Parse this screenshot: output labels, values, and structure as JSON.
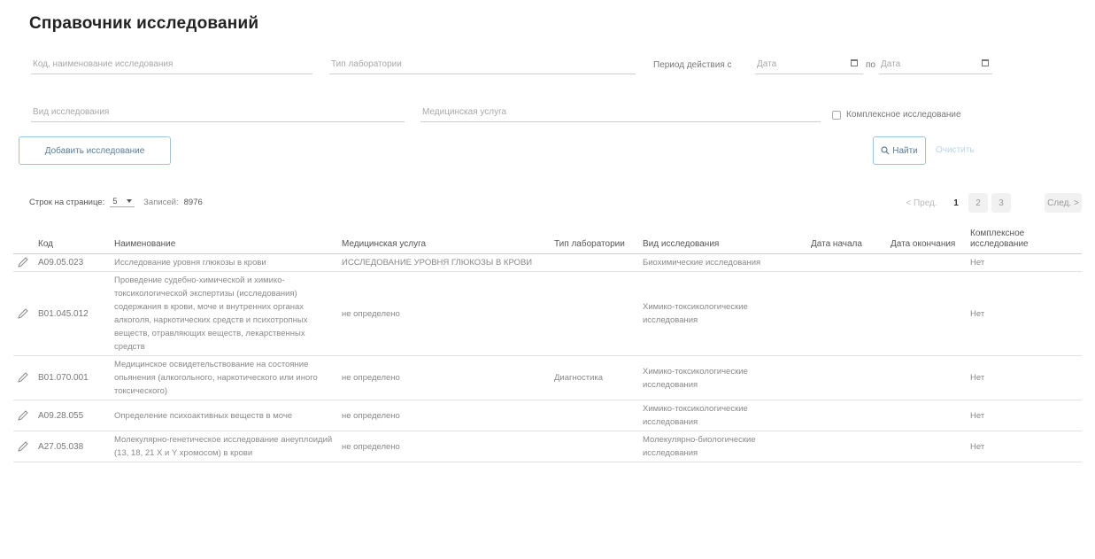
{
  "page": {
    "title": "Справочник исследований"
  },
  "filters": {
    "code_placeholder": "Код, наименование исследования",
    "lab_type_placeholder": "Тип лаборатории",
    "period_label": "Период действия с",
    "date_from_placeholder": "Дата",
    "to_label": "по",
    "date_to_placeholder": "Дата",
    "study_type_placeholder": "Вид исследования",
    "med_service_placeholder": "Медицинская услуга",
    "complex_label": "Комплексное исследование"
  },
  "actions": {
    "add_label": "Добавить исследование",
    "find_label": "Найти",
    "clear_label": "Очистить"
  },
  "pagination": {
    "rows_per_page_label": "Строк на странице:",
    "rows_per_page_value": "5",
    "records_label": "Записей:",
    "records_count": "8976",
    "prev_label": "< Пред.",
    "pages": [
      "1",
      "2",
      "3"
    ],
    "next_label": "След. >"
  },
  "table": {
    "headers": {
      "code": "Код",
      "name": "Наименование",
      "service": "Медицинская услуга",
      "lab": "Тип лаборатории",
      "type": "Вид исследования",
      "start": "Дата начала",
      "end": "Дата окончания",
      "complex": "Комплексное исследование"
    },
    "rows": [
      {
        "code": "A09.05.023",
        "name": "Исследование уровня глюкозы в крови",
        "service": "ИССЛЕДОВАНИЕ УРОВНЯ ГЛЮКОЗЫ В КРОВИ",
        "lab": "",
        "type": "Биохимические исследования",
        "start": "",
        "end": "",
        "complex": "Нет"
      },
      {
        "code": "B01.045.012",
        "name": "Проведение судебно-химической и химико-токсикологической экспертизы (исследования) содержания в крови, моче и внутренних органах алкоголя, наркотических средств и психотропных веществ, отравляющих веществ, лекарственных средств",
        "service": "не определено",
        "lab": "",
        "type": "Химико-токсикологические исследования",
        "start": "",
        "end": "",
        "complex": "Нет"
      },
      {
        "code": "B01.070.001",
        "name": "Медицинское освидетельствование на состояние опьянения (алкогольного, наркотического или иного токсического)",
        "service": "не определено",
        "lab": "Диагностика",
        "type": "Химико-токсикологические исследования",
        "start": "",
        "end": "",
        "complex": "Нет"
      },
      {
        "code": "A09.28.055",
        "name": "Определение психоактивных веществ в моче",
        "service": "не определено",
        "lab": "",
        "type": "Химико-токсикологические исследования",
        "start": "",
        "end": "",
        "complex": "Нет"
      },
      {
        "code": "A27.05.038",
        "name": "Молекулярно-генетическое исследование анеуплоидий (13, 18, 21 X и Y хромосом) в крови",
        "service": "не определено",
        "lab": "",
        "type": "Молекулярно-биологические исследования",
        "start": "",
        "end": "",
        "complex": "Нет"
      }
    ]
  }
}
